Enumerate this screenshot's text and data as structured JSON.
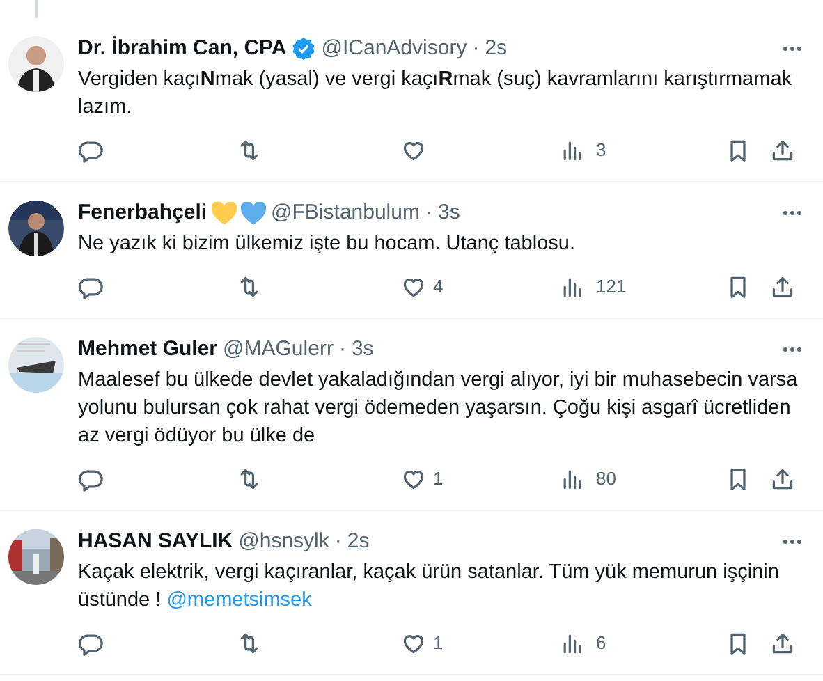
{
  "tweets": [
    {
      "name": "Dr. İbrahim Can, CPA",
      "verified": true,
      "handle": "@ICanAdvisory",
      "separator": "·",
      "time": "2s",
      "text": "Vergiden kaçı**N**mak (yasal) ve vergi kaçı**R**mak (suç) kavramlarını karıştırmamak lazım.",
      "views": "3",
      "thread_above": true
    },
    {
      "name": "Fenerbahçeli",
      "badges": [
        {
          "kind": "heart",
          "color": "#ffcc4d"
        },
        {
          "kind": "heart",
          "color": "#5dadec"
        }
      ],
      "handle": "@FBistanbulum",
      "separator": "·",
      "time": "3s",
      "text": "Ne yazık ki bizim ülkemiz işte bu hocam. Utanç tablosu.",
      "likes": "4",
      "views": "121"
    },
    {
      "name": "Mehmet Guler",
      "handle": "@MAGulerr",
      "separator": "·",
      "time": "3s",
      "text": "Maalesef bu ülkede devlet yakaladığından vergi alıyor, iyi bir muhasebecin varsa yolunu bulursan çok rahat vergi ödemeden yaşarsın. Çoğu kişi asgarî ücretliden az vergi ödüyor bu ülke de",
      "likes": "1",
      "views": "80"
    },
    {
      "name": "HASAN SAYLIK",
      "handle": "@hsnsylk",
      "separator": "·",
      "time": "2s",
      "text": "Kaçak elektrik, vergi kaçıranlar, kaçak ürün satanlar. Tüm yük memurun işçinin üstünde !",
      "mention": "@memetsimsek",
      "likes": "1",
      "views": "6"
    }
  ]
}
